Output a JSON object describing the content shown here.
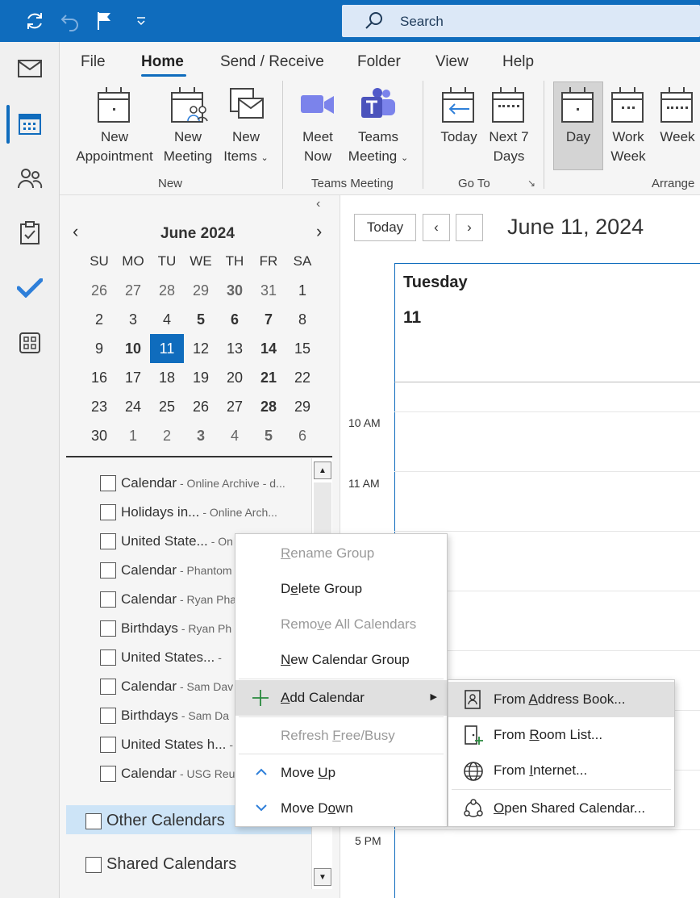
{
  "titlebar": {
    "search_label": "Search"
  },
  "ribbon": {
    "tabs": [
      "File",
      "Home",
      "Send / Receive",
      "Folder",
      "View",
      "Help"
    ],
    "buttons": {
      "new_appointment": [
        "New",
        "Appointment"
      ],
      "new_meeting": [
        "New",
        "Meeting"
      ],
      "new_items": [
        "New",
        "Items"
      ],
      "meet_now": [
        "Meet",
        "Now"
      ],
      "teams_meeting": [
        "Teams",
        "Meeting"
      ],
      "today": [
        "Today"
      ],
      "next7": [
        "Next 7",
        "Days"
      ],
      "day": [
        "Day"
      ],
      "work_week": [
        "Work",
        "Week"
      ],
      "week": [
        "Week"
      ]
    },
    "groups": {
      "new": "New",
      "teams": "Teams Meeting",
      "goto": "Go To",
      "arrange": "Arrange"
    }
  },
  "minical": {
    "title": "June 2024",
    "weekdays": [
      "SU",
      "MO",
      "TU",
      "WE",
      "TH",
      "FR",
      "SA"
    ],
    "weeks": [
      [
        "26",
        "27",
        "28",
        "29",
        "30",
        "31",
        "1"
      ],
      [
        "2",
        "3",
        "4",
        "5",
        "6",
        "7",
        "8"
      ],
      [
        "9",
        "10",
        "11",
        "12",
        "13",
        "14",
        "15"
      ],
      [
        "16",
        "17",
        "18",
        "19",
        "20",
        "21",
        "22"
      ],
      [
        "23",
        "24",
        "25",
        "26",
        "27",
        "28",
        "29"
      ],
      [
        "30",
        "1",
        "2",
        "3",
        "4",
        "5",
        "6"
      ]
    ]
  },
  "calendars": [
    {
      "name": "Calendar",
      "sub": "- Online Archive - d..."
    },
    {
      "name": "Holidays in...",
      "sub": "- Online Arch..."
    },
    {
      "name": "United State...",
      "sub": "- On"
    },
    {
      "name": "Calendar",
      "sub": "- Phantom"
    },
    {
      "name": "Calendar",
      "sub": "- Ryan Pha"
    },
    {
      "name": "Birthdays",
      "sub": "- Ryan Ph"
    },
    {
      "name": "United States...",
      "sub": "-"
    },
    {
      "name": "Calendar",
      "sub": "- Sam Dav"
    },
    {
      "name": "Birthdays",
      "sub": "- Sam Da"
    },
    {
      "name": "United States h...",
      "sub": "-"
    },
    {
      "name": "Calendar",
      "sub": "- USG Reu"
    }
  ],
  "groups_list": {
    "other": "Other Calendars",
    "shared": "Shared Calendars"
  },
  "calview": {
    "today_btn": "Today",
    "date_title": "June 11, 2024",
    "day_name": "Tuesday",
    "day_num": "11",
    "times": [
      "10 AM",
      "11 AM",
      "5 PM"
    ]
  },
  "context_menu": {
    "items": [
      {
        "pre": "",
        "u": "R",
        "post": "ename Group"
      },
      {
        "pre": "D",
        "u": "e",
        "post": "lete Group"
      },
      {
        "pre": "Remo",
        "u": "v",
        "post": "e All Calendars"
      },
      {
        "pre": "",
        "u": "N",
        "post": "ew Calendar Group"
      },
      {
        "pre": "",
        "u": "A",
        "post": "dd Calendar"
      },
      {
        "pre": "Refresh ",
        "u": "F",
        "post": "ree/Busy"
      },
      {
        "pre": "Move ",
        "u": "U",
        "post": "p"
      },
      {
        "pre": "Move D",
        "u": "o",
        "post": "wn"
      }
    ]
  },
  "submenu": {
    "items": [
      {
        "pre": "From ",
        "u": "A",
        "post": "ddress Book..."
      },
      {
        "pre": "From ",
        "u": "R",
        "post": "oom List..."
      },
      {
        "pre": "From ",
        "u": "I",
        "post": "nternet..."
      },
      {
        "pre": "",
        "u": "O",
        "post": "pen Shared Calendar..."
      }
    ]
  },
  "colors": {
    "accent": "#0f6cbd",
    "highlight": "#e0e0e0",
    "selected_group": "#cde4f7"
  }
}
